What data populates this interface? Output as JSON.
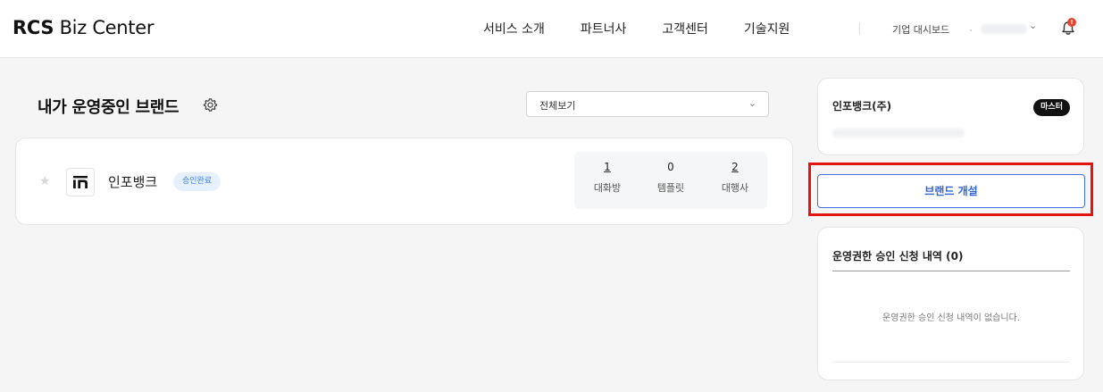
{
  "header": {
    "logo_bold": "RCS",
    "logo_rest": " Biz Center",
    "nav": [
      "서비스 소개",
      "파트너사",
      "고객센터",
      "기술지원"
    ],
    "dashboard_link": "기업 대시보드",
    "notification_badge": "!",
    "icons": {
      "user_menu": "chevron-down-icon",
      "notifications": "bell-icon"
    }
  },
  "main": {
    "title": "내가 운영중인 브랜드",
    "filter_select": {
      "selected": "전체보기"
    },
    "brands": [
      {
        "name": "인포뱅크",
        "logo_text": "in",
        "status": "승인완료",
        "stats": [
          {
            "value": "1",
            "label": "대화방"
          },
          {
            "value": "0",
            "label": "템플릿"
          },
          {
            "value": "2",
            "label": "대행사"
          }
        ]
      }
    ]
  },
  "sidebar": {
    "company": {
      "name": "인포뱅크(주)",
      "role_badge": "마스터"
    },
    "open_brand_label": "브랜드 개설",
    "requests": {
      "title": "운영권한 승인 신청 내역 (0)",
      "empty_text": "운영권한 승인 신청 내역이 없습니다."
    }
  },
  "colors": {
    "accent": "#2f64d6",
    "highlight": "#e4140f",
    "badge_red": "#e8452c",
    "status_badge_bg": "#e7f0fd"
  }
}
